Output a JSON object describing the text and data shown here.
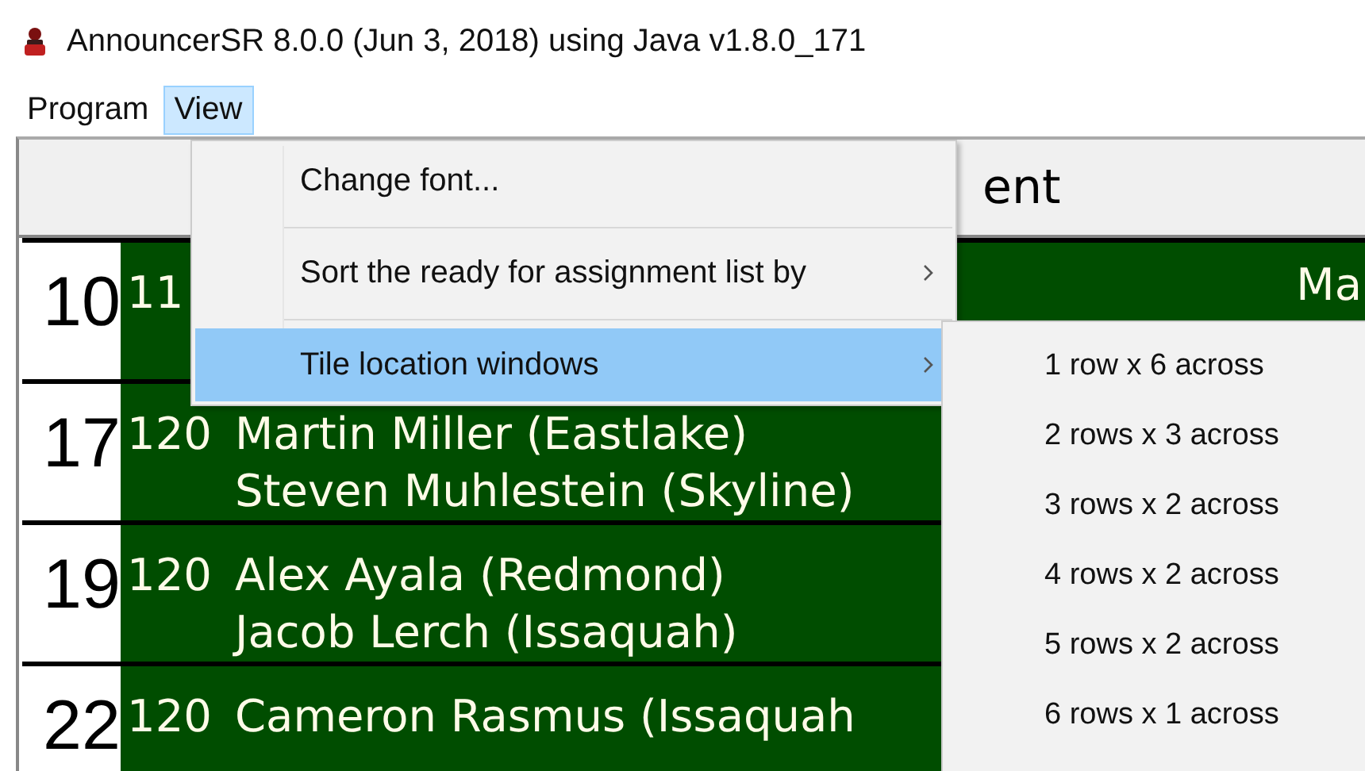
{
  "window": {
    "title": "AnnouncerSR 8.0.0 (Jun 3, 2018) using Java v1.8.0_171"
  },
  "menubar": [
    {
      "label": "Program",
      "selected": false
    },
    {
      "label": "View",
      "selected": true
    }
  ],
  "table": {
    "header": "ent",
    "rows": [
      {
        "number": "10",
        "score": "11",
        "lines": [],
        "right": "Ma"
      },
      {
        "number": "17",
        "score": "120",
        "lines": [
          "Martin Miller (Eastlake)",
          "Steven Muhlestein (Skyline)"
        ]
      },
      {
        "number": "19",
        "score": "120",
        "lines": [
          "Alex Ayala (Redmond)",
          "Jacob Lerch (Issaquah)"
        ]
      },
      {
        "number": "22",
        "score": "120",
        "lines": [
          "Cameron Rasmus (Issaquah"
        ]
      }
    ]
  },
  "menu": {
    "items": [
      {
        "kind": "item",
        "label": "Change font...",
        "submenu": false,
        "selected": false
      },
      {
        "kind": "separator"
      },
      {
        "kind": "item",
        "label": "Sort the ready for assignment list by",
        "submenu": true,
        "selected": false
      },
      {
        "kind": "separator"
      },
      {
        "kind": "item",
        "label": "Tile location windows",
        "submenu": true,
        "selected": true
      }
    ]
  },
  "submenu": {
    "items": [
      {
        "label": "1 row x 6 across"
      },
      {
        "label": "2 rows x 3 across"
      },
      {
        "label": "3 rows x 2 across"
      },
      {
        "label": "4 rows x 2 across"
      },
      {
        "label": "5 rows x 2 across"
      },
      {
        "label": "6 rows x 1 across"
      }
    ]
  }
}
